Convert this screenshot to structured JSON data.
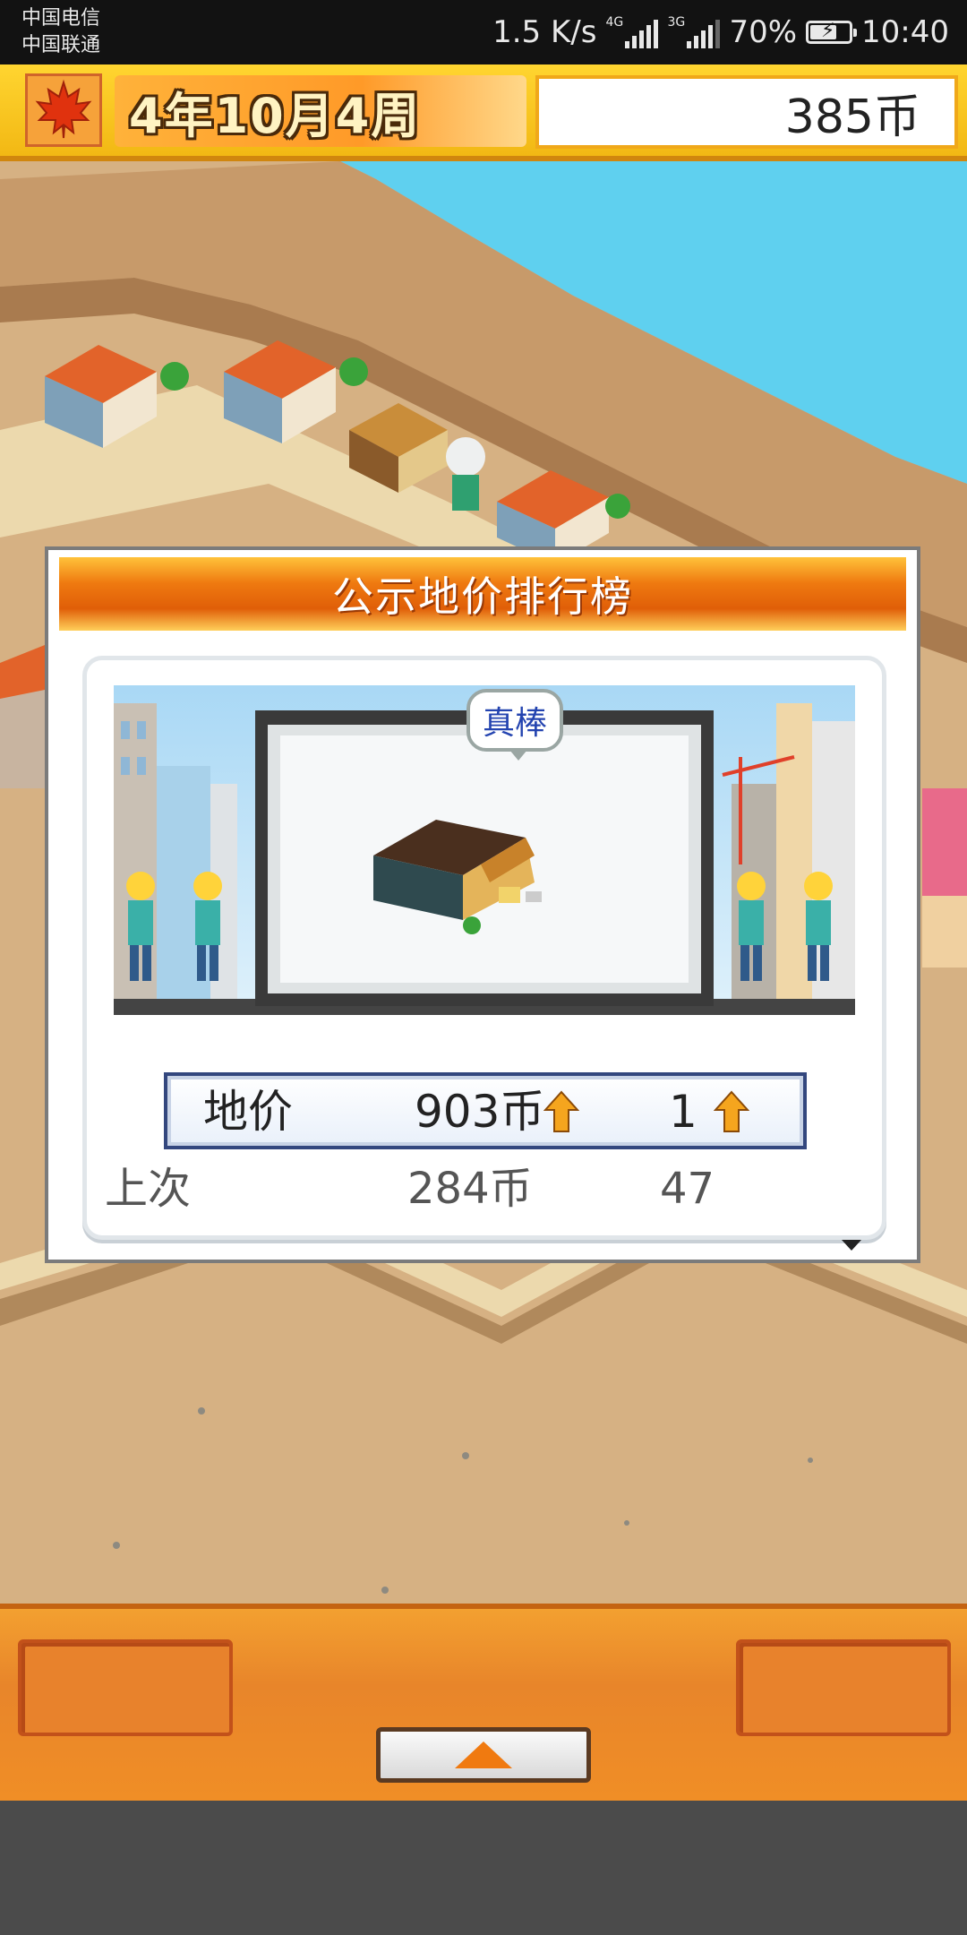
{
  "status_bar": {
    "carrier_1": "中国电信",
    "carrier_2": "中国联通",
    "net_speed": "1.5 K/s",
    "sim1_tag": "4G",
    "sim2_tag": "3G",
    "battery": "70%",
    "battery_level": 0.7,
    "time": "10:40"
  },
  "hud": {
    "season_icon": "maple-leaf-icon",
    "date": "4年10月4周",
    "money": "385币"
  },
  "popup": {
    "title": "公示地价排行榜",
    "bubble": "真棒",
    "current": {
      "label": "地价",
      "price": "903币",
      "rank": "1",
      "price_trend": "up",
      "rank_trend": "up"
    },
    "previous": {
      "label": "上次",
      "price": "284币",
      "rank": "47"
    }
  },
  "bottom_bar": {
    "left_button": "",
    "right_button": "",
    "up_icon": "triangle-up-icon"
  },
  "colors": {
    "hud_yellow": "#f8c820",
    "popup_orange": "#e8670a",
    "trend_arrow": "#f5a51e",
    "stats_border": "#33477e"
  }
}
